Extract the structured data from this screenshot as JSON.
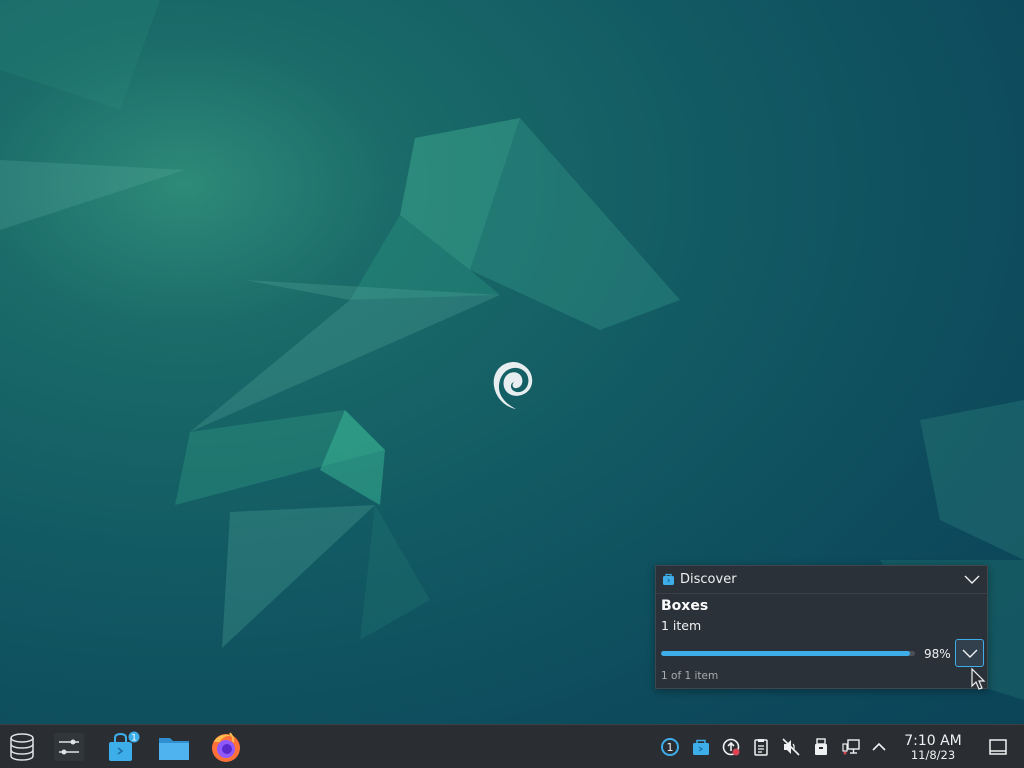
{
  "notification": {
    "app_name": "Discover",
    "title": "Boxes",
    "subtitle": "1 item",
    "progress_value": 0.98,
    "progress_label": "98%",
    "footer": "1 of 1 item"
  },
  "taskbar": {
    "launchers": [
      {
        "name": "application-launcher",
        "icon": "database-icon"
      },
      {
        "name": "system-settings",
        "icon": "sliders-icon"
      },
      {
        "name": "discover",
        "icon": "shopping-bag-icon",
        "badge": "1"
      },
      {
        "name": "files",
        "icon": "folder-icon"
      },
      {
        "name": "firefox",
        "icon": "firefox-icon"
      }
    ],
    "tray": {
      "notifications_badge": "1",
      "icons": [
        "notifications-icon",
        "discover-tray-icon",
        "updates-icon",
        "clipboard-icon",
        "volume-muted-icon",
        "removable-device-icon",
        "network-icon",
        "show-hidden-icon"
      ]
    },
    "clock": {
      "time": "7:10 AM",
      "date": "11/8/23"
    }
  },
  "colors": {
    "accent": "#3daee9",
    "panel": "#2a2e32",
    "popup": "#2b3138"
  }
}
